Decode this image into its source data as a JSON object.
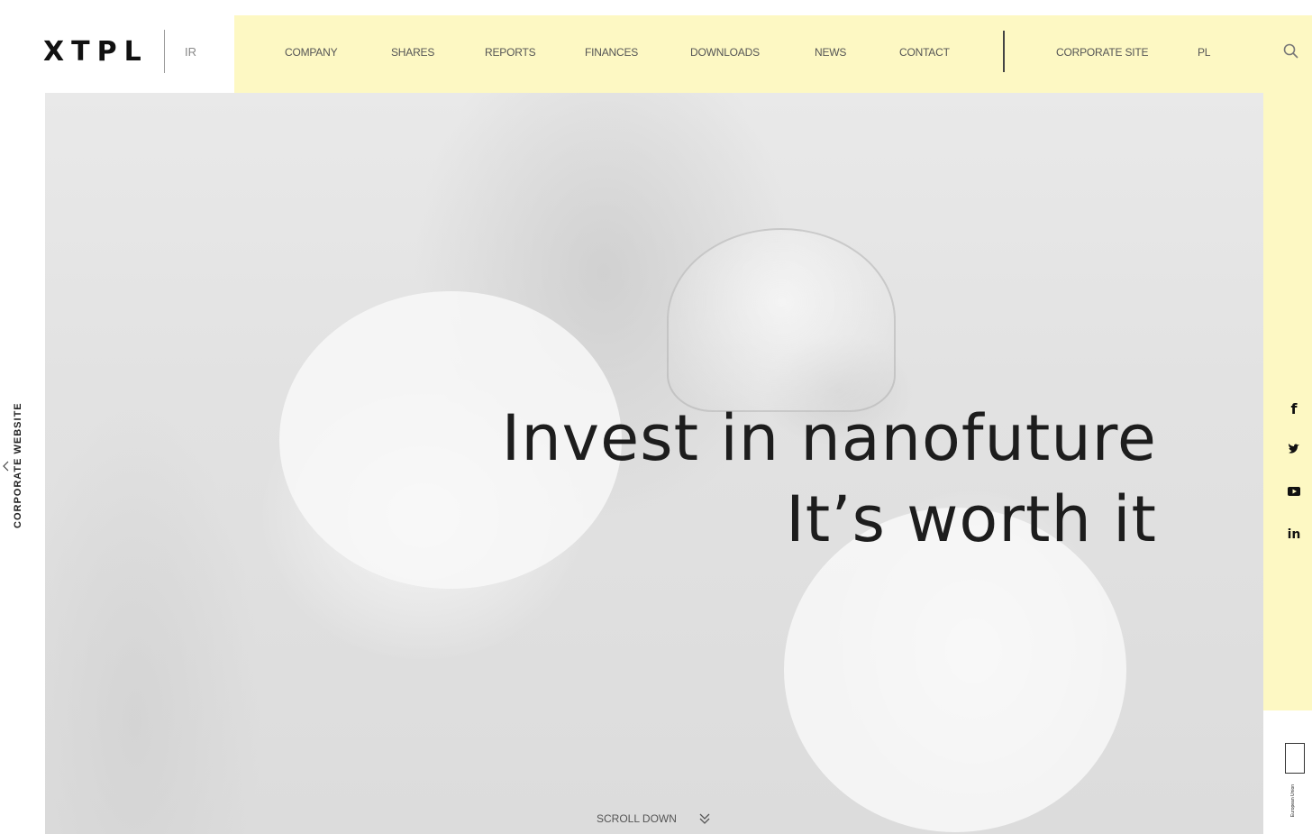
{
  "brand": {
    "logo_text": "XTPL",
    "section_label": "IR"
  },
  "nav": {
    "items": [
      {
        "label": "COMPANY"
      },
      {
        "label": "SHARES"
      },
      {
        "label": "REPORTS"
      },
      {
        "label": "FINANCES"
      },
      {
        "label": "DOWNLOADS"
      },
      {
        "label": "NEWS"
      },
      {
        "label": "CONTACT"
      }
    ],
    "secondary": [
      {
        "label": "CORPORATE SITE"
      },
      {
        "label": "PL"
      }
    ],
    "search_icon": "search-icon"
  },
  "hero": {
    "headline_line1": "Invest in nanofuture",
    "headline_line2": "It’s worth it",
    "scroll_label": "SCROLL DOWN"
  },
  "side": {
    "corporate_label": "CORPORATE WEBSITE"
  },
  "social": [
    {
      "icon": "facebook-icon",
      "glyph": "f"
    },
    {
      "icon": "twitter-icon",
      "glyph": "t"
    },
    {
      "icon": "youtube-icon",
      "glyph": "▶"
    },
    {
      "icon": "linkedin-icon",
      "glyph": "in"
    }
  ],
  "eu": {
    "label": "European Union"
  },
  "colors": {
    "accent_yellow": "#fdf8c3",
    "text_dark": "#1d1d1d"
  }
}
